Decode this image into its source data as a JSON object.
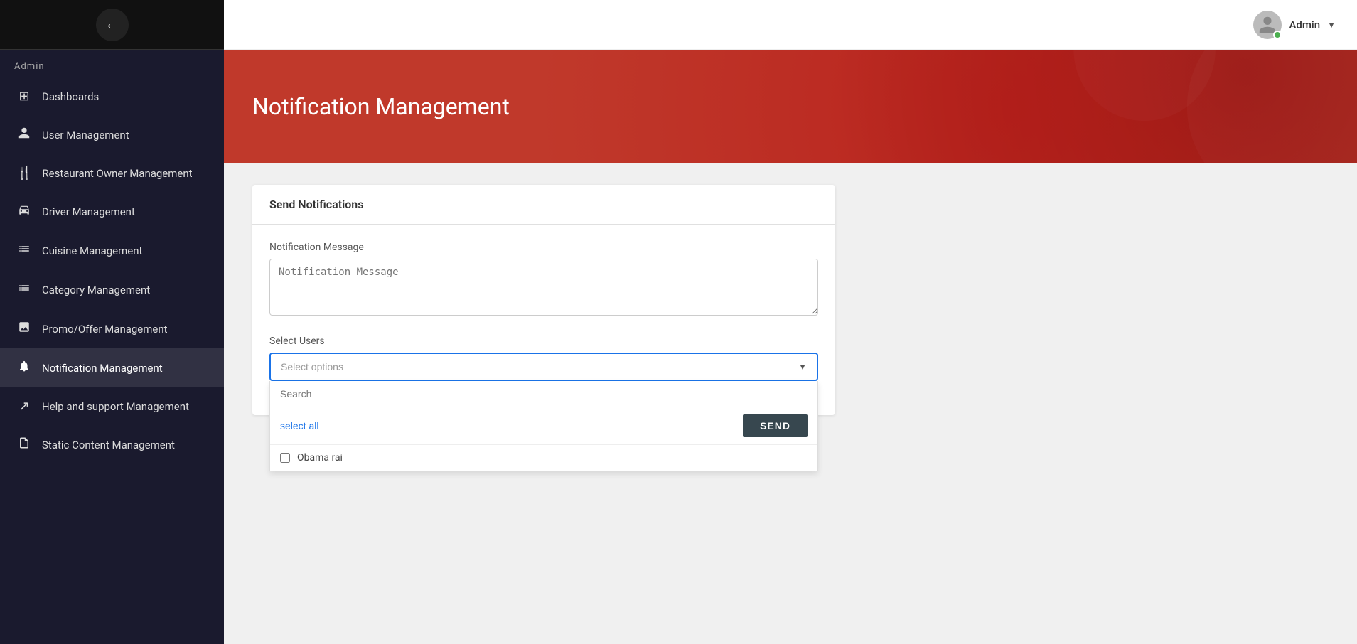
{
  "sidebar": {
    "admin_label": "Admin",
    "toggle_icon": "←",
    "items": [
      {
        "id": "dashboards",
        "label": "Dashboards",
        "icon": "⊞"
      },
      {
        "id": "user-management",
        "label": "User Management",
        "icon": "👤"
      },
      {
        "id": "restaurant-owner-management",
        "label": "Restaurant Owner Management",
        "icon": "🍴"
      },
      {
        "id": "driver-management",
        "label": "Driver Management",
        "icon": "🚗"
      },
      {
        "id": "cuisine-management",
        "label": "Cuisine Management",
        "icon": "📊"
      },
      {
        "id": "category-management",
        "label": "Category Management",
        "icon": "📊"
      },
      {
        "id": "promo-offer-management",
        "label": "Promo/Offer Management",
        "icon": "🖼️"
      },
      {
        "id": "notification-management",
        "label": "Notification Management",
        "icon": "🔔",
        "active": true
      },
      {
        "id": "help-support-management",
        "label": "Help and support Management",
        "icon": "↗"
      },
      {
        "id": "static-content-management",
        "label": "Static Content Management",
        "icon": "📄"
      }
    ]
  },
  "topbar": {
    "username": "Admin",
    "chevron": "▼"
  },
  "hero": {
    "title": "Notification Management"
  },
  "card": {
    "header": "Send Notifications",
    "notification_message_label": "Notification Message",
    "notification_message_placeholder": "Notification Message",
    "select_users_label": "Select Users",
    "select_options_placeholder": "Select options",
    "search_placeholder": "Search",
    "select_all_label": "select all",
    "send_button_label": "SEND",
    "dropdown_items": [
      {
        "id": "obama-rai",
        "label": "Obama rai",
        "checked": false
      }
    ]
  }
}
